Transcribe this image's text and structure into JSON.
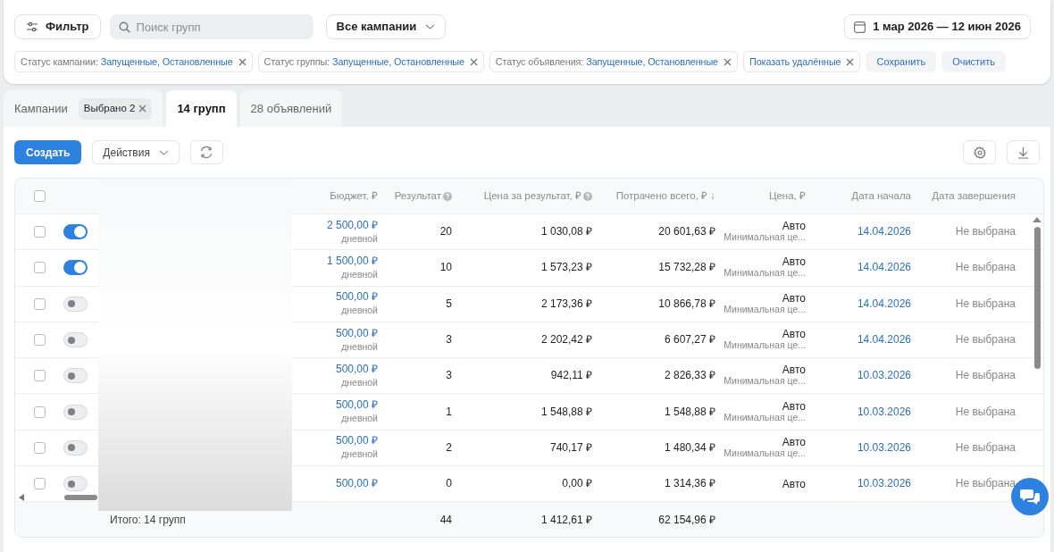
{
  "toolbar": {
    "filter_button": "Фильтр",
    "search": {
      "placeholder": "Поиск групп"
    },
    "campaign_select": "Все кампании",
    "date_range": "1 мар 2026 — 12 июн 2026"
  },
  "filter_chips": [
    {
      "label": "Статус кампании:",
      "value": "Запущенные, Остановленные"
    },
    {
      "label": "Статус группы:",
      "value": "Запущенные, Остановленные"
    },
    {
      "label": "Статус объявления:",
      "value": "Запущенные, Остановленные"
    },
    {
      "value": "Показать удалённые"
    }
  ],
  "filter_actions": [
    "Сохранить",
    "Очистить"
  ],
  "tabs": [
    {
      "label": "Кампании",
      "chip": "Выбрано 2",
      "selected": false
    },
    {
      "label": "14 групп",
      "selected": true
    },
    {
      "label": "28 объявлений",
      "selected": false
    }
  ],
  "actions": {
    "create": "Создать",
    "actions_menu": "Действия"
  },
  "table": {
    "select_all": {
      "checked": false
    },
    "columns": [
      {
        "label": "Бюджет, ₽"
      },
      {
        "label": "Результат",
        "help": true
      },
      {
        "label": "Цена за результат, ₽",
        "help": true
      },
      {
        "label": "Потрачено всего, ₽ ↓"
      },
      {
        "label": "Цена, ₽"
      },
      {
        "label": "Дата начала"
      },
      {
        "label": "Дата завершения"
      }
    ],
    "rows": [
      {
        "checked": false,
        "on": true,
        "budget": "2 500,00 ₽",
        "period": "дневной",
        "result": "20",
        "cpr": "1 030,08 ₽",
        "spent": "20 601,63 ₽",
        "price": "Авто",
        "price_note": "Минимальная це...",
        "start": "14.04.2026",
        "end": "Не выбрана"
      },
      {
        "checked": false,
        "on": true,
        "budget": "1 500,00 ₽",
        "period": "дневной",
        "result": "10",
        "cpr": "1 573,23 ₽",
        "spent": "15 732,28 ₽",
        "price": "Авто",
        "price_note": "Минимальная це...",
        "start": "14.04.2026",
        "end": "Не выбрана"
      },
      {
        "checked": false,
        "on": false,
        "budget": "500,00 ₽",
        "period": "дневной",
        "result": "5",
        "cpr": "2 173,36 ₽",
        "spent": "10 866,78 ₽",
        "price": "Авто",
        "price_note": "Минимальная це...",
        "start": "14.04.2026",
        "end": "Не выбрана"
      },
      {
        "checked": false,
        "on": false,
        "budget": "500,00 ₽",
        "period": "дневной",
        "result": "3",
        "cpr": "2 202,42 ₽",
        "spent": "6 607,27 ₽",
        "price": "Авто",
        "price_note": "Минимальная це...",
        "start": "14.04.2026",
        "end": "Не выбрана"
      },
      {
        "checked": false,
        "on": false,
        "budget": "500,00 ₽",
        "period": "дневной",
        "result": "3",
        "cpr": "942,11 ₽",
        "spent": "2 826,33 ₽",
        "price": "Авто",
        "price_note": "Минимальная це...",
        "start": "10.03.2026",
        "end": "Не выбрана"
      },
      {
        "checked": false,
        "on": false,
        "budget": "500,00 ₽",
        "period": "дневной",
        "result": "1",
        "cpr": "1 548,88 ₽",
        "spent": "1 548,88 ₽",
        "price": "Авто",
        "price_note": "Минимальная це...",
        "start": "10.03.2026",
        "end": "Не выбрана"
      },
      {
        "checked": false,
        "on": false,
        "budget": "500,00 ₽",
        "period": "дневной",
        "result": "2",
        "cpr": "740,17 ₽",
        "spent": "1 480,34 ₽",
        "price": "Авто",
        "price_note": "Минимальная це...",
        "start": "10.03.2026",
        "end": "Не выбрана"
      },
      {
        "checked": false,
        "on": false,
        "budget": "500,00 ₽",
        "result": "0",
        "cpr": "0,00 ₽",
        "spent": "1 314,36 ₽",
        "price": "Авто",
        "start": "10.03.2026",
        "end": "Не выбрана"
      }
    ],
    "totals": {
      "label": "Итого: 14 групп",
      "result": "44",
      "cpr": "1 412,61 ₽",
      "spent": "62 154,96 ₽"
    }
  }
}
